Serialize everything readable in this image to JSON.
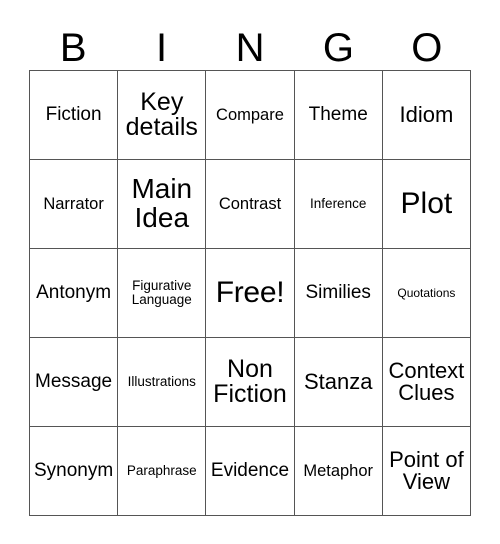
{
  "card": {
    "title": "BINGO",
    "header_letters": [
      "B",
      "I",
      "N",
      "G",
      "O"
    ],
    "columns": 5,
    "rows": 5,
    "free_space_label": "Free!",
    "free_space_index": 12,
    "border_color": "#555555",
    "text_color": "#000000",
    "background_color": "#ffffff",
    "cells": [
      {
        "label": "Fiction",
        "size": "l"
      },
      {
        "label": "Key\ndetails",
        "size": "2xl"
      },
      {
        "label": "Compare",
        "size": "m"
      },
      {
        "label": "Theme",
        "size": "l"
      },
      {
        "label": "Idiom",
        "size": "xl"
      },
      {
        "label": "Narrator",
        "size": "m"
      },
      {
        "label": "Main\nIdea",
        "size": "3xl"
      },
      {
        "label": "Contrast",
        "size": "m"
      },
      {
        "label": "Inference",
        "size": "s"
      },
      {
        "label": "Plot",
        "size": "4xl"
      },
      {
        "label": "Antonym",
        "size": "l"
      },
      {
        "label": "Figurative\nLanguage",
        "size": "s"
      },
      {
        "label": "Free!",
        "size": "4xl"
      },
      {
        "label": "Similies",
        "size": "l"
      },
      {
        "label": "Quotations",
        "size": "xs"
      },
      {
        "label": "Message",
        "size": "l"
      },
      {
        "label": "Illustrations",
        "size": "s"
      },
      {
        "label": "Non\nFiction",
        "size": "2xl"
      },
      {
        "label": "Stanza",
        "size": "xl"
      },
      {
        "label": "Context\nClues",
        "size": "xl"
      },
      {
        "label": "Synonym",
        "size": "l"
      },
      {
        "label": "Paraphrase",
        "size": "s"
      },
      {
        "label": "Evidence",
        "size": "l"
      },
      {
        "label": "Metaphor",
        "size": "m"
      },
      {
        "label": "Point of\nView",
        "size": "xl"
      }
    ]
  }
}
